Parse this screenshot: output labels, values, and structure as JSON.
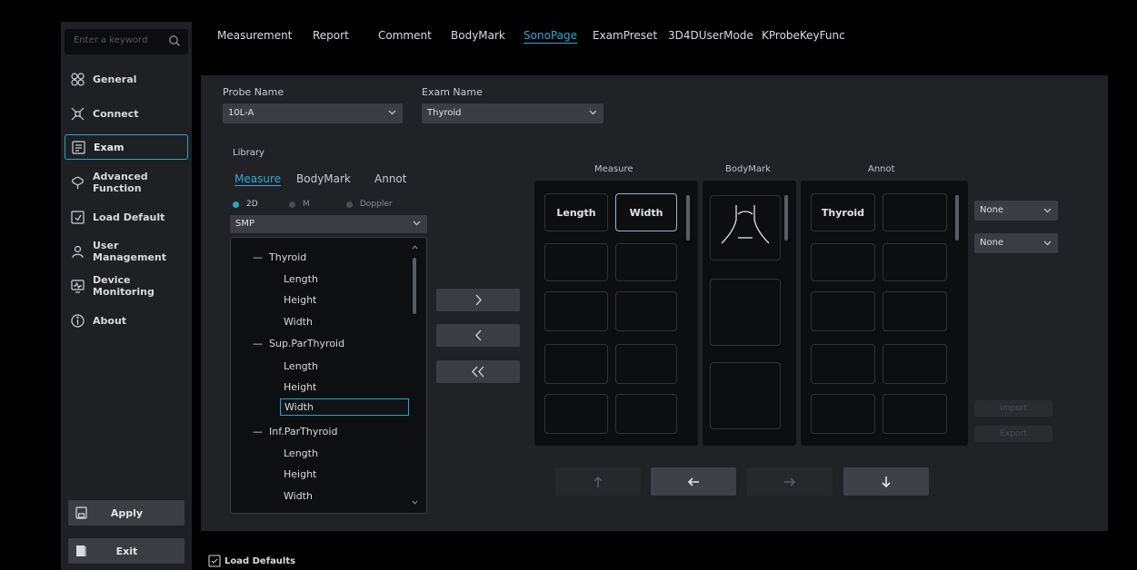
{
  "sidebar": {
    "search_placeholder": "Enter a keyword",
    "items": [
      {
        "label": "General",
        "icon": "settings-general-icon"
      },
      {
        "label": "Connect",
        "icon": "connect-icon"
      },
      {
        "label": "Exam",
        "icon": "exam-icon"
      },
      {
        "label": "Advanced Function",
        "icon": "advanced-function-icon"
      },
      {
        "label": "Load Default",
        "icon": "load-default-icon"
      },
      {
        "label": "User Management",
        "icon": "user-management-icon"
      },
      {
        "label": "Device Monitoring",
        "icon": "device-monitoring-icon"
      },
      {
        "label": "About",
        "icon": "about-icon"
      }
    ],
    "active_item": "Exam",
    "apply_label": "Apply",
    "exit_label": "Exit"
  },
  "tabs": [
    "Measurement",
    "Report",
    "Comment",
    "BodyMark",
    "SonoPage",
    "ExamPreset",
    "3D4DUserMode",
    "KProbeKeyFunc"
  ],
  "active_tab": "SonoPage",
  "probe": {
    "label": "Probe Name",
    "value": "10L-A"
  },
  "exam": {
    "label": "Exam Name",
    "value": "Thyroid"
  },
  "library": {
    "label": "Library",
    "tabs": [
      "Measure",
      "BodyMark",
      "Annot"
    ],
    "active_tab": "Measure",
    "modes": [
      "2D",
      "M",
      "Doppler"
    ],
    "active_mode": "2D",
    "filter_value": "SMP",
    "tree": [
      {
        "label": "Thyroid",
        "level": 0
      },
      {
        "label": "Length",
        "level": 1
      },
      {
        "label": "Height",
        "level": 1
      },
      {
        "label": "Width",
        "level": 1
      },
      {
        "label": "Sup.ParThyroid",
        "level": 0
      },
      {
        "label": "Length",
        "level": 1
      },
      {
        "label": "Height",
        "level": 1
      },
      {
        "label": "Width",
        "level": 1,
        "selected": true
      },
      {
        "label": "Inf.ParThyroid",
        "level": 0
      },
      {
        "label": "Length",
        "level": 1
      },
      {
        "label": "Height",
        "level": 1
      },
      {
        "label": "Width",
        "level": 1
      }
    ]
  },
  "grid_headers": {
    "measure": "Measure",
    "bodymark": "BodyMark",
    "annot": "Annot"
  },
  "measure_cells": [
    "Length",
    "Width"
  ],
  "bodymark_cells": [
    "neck-bodymark"
  ],
  "annot_cells": [
    "Thyroid"
  ],
  "right_selects": [
    "None",
    "None"
  ],
  "right_buttons": [
    "Import",
    "Export"
  ],
  "footer_link": "Load Defaults",
  "colors": {
    "accent": "#2aa3c9",
    "panel": "#202226",
    "sidebar": "#1e2023"
  }
}
